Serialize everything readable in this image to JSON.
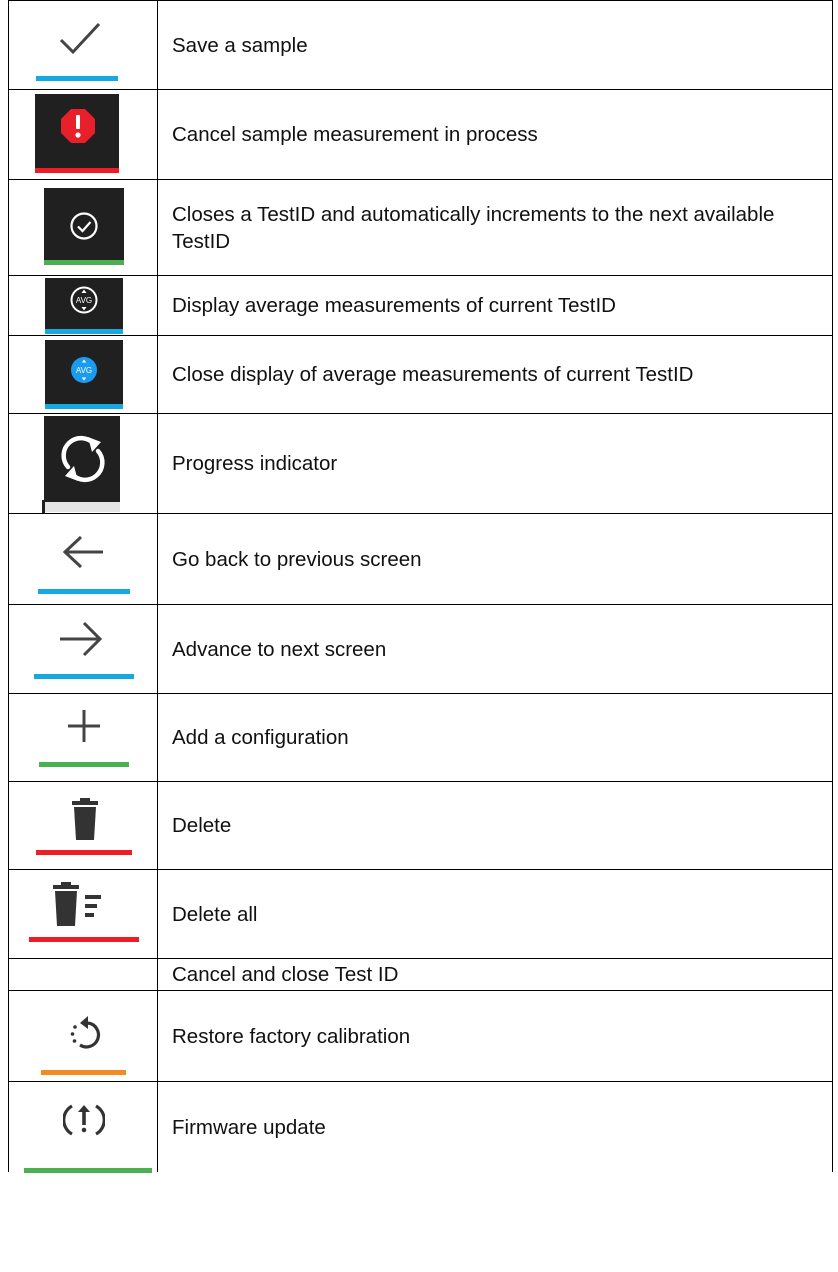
{
  "rows": [
    {
      "icon": "checkmark-icon",
      "label": "Save a sample",
      "accent": "#16a9e1"
    },
    {
      "icon": "alert-stop-icon",
      "label": "Cancel sample measurement in process",
      "accent": "#ee1c25"
    },
    {
      "icon": "check-circle-icon",
      "label": "Closes a TestID and automatically increments to the next available TestID",
      "accent": "#4caf50"
    },
    {
      "icon": "avg-display-icon",
      "label": "Display average measurements of current TestID",
      "accent": "#16a9e1",
      "glyph": "AVG"
    },
    {
      "icon": "avg-close-icon",
      "label": "Close display of average measurements of current TestID",
      "accent": "#16a9e1",
      "glyph": "AVG"
    },
    {
      "icon": "progress-icon",
      "label": "Progress indicator"
    },
    {
      "icon": "arrow-left-icon",
      "label": "Go back to previous screen",
      "accent": "#16a9e1"
    },
    {
      "icon": "arrow-right-icon",
      "label": "Advance to next screen",
      "accent": "#16a9e1"
    },
    {
      "icon": "plus-icon",
      "label": "Add a configuration",
      "accent": "#4caf50"
    },
    {
      "icon": "trash-icon",
      "label": "Delete",
      "accent": "#ee1c25"
    },
    {
      "icon": "trash-list-icon",
      "label": "Delete all",
      "accent": "#ee1c25"
    },
    {
      "icon": "",
      "label": "Cancel and close Test ID"
    },
    {
      "icon": "restore-icon",
      "label": "Restore factory calibration",
      "accent": "#f28b20"
    },
    {
      "icon": "upload-icon",
      "label": "Firmware update",
      "accent": "#4caf50"
    }
  ]
}
